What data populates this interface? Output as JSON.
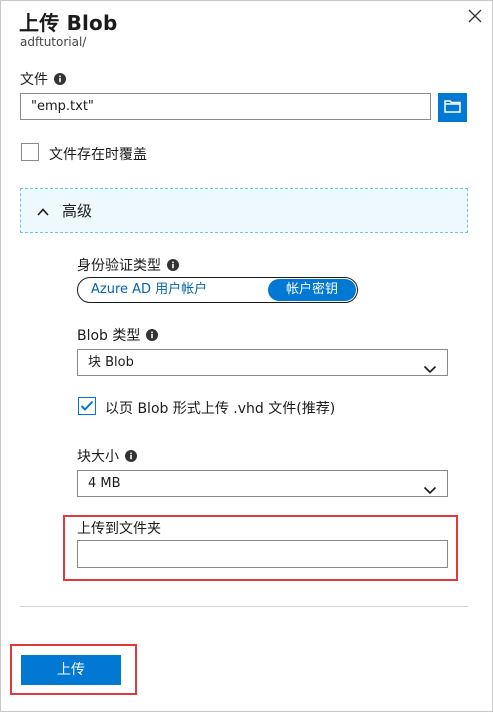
{
  "header": {
    "title": "上传 Blob",
    "subtitle": "adftutorial/"
  },
  "file": {
    "label": "文件",
    "value": "\"emp.txt\""
  },
  "overwrite": {
    "label": "文件存在时覆盖",
    "checked": false
  },
  "advanced": {
    "label": "高级",
    "expanded": true
  },
  "auth": {
    "label": "身份验证类型",
    "option_1": "Azure AD 用户帐户",
    "option_2": "帐户密钥",
    "selected": "帐户密钥"
  },
  "blob_type": {
    "label": "Blob 类型",
    "value": "块 Blob"
  },
  "vhd": {
    "label": "以页 Blob 形式上传 .vhd 文件(推荐)",
    "checked": true
  },
  "block_size": {
    "label": "块大小",
    "value": "4 MB"
  },
  "folder": {
    "label": "上传到文件夹",
    "value": ""
  },
  "footer": {
    "upload_label": "上传"
  },
  "colors": {
    "accent": "#0078d4",
    "highlight": "#e1393b"
  }
}
